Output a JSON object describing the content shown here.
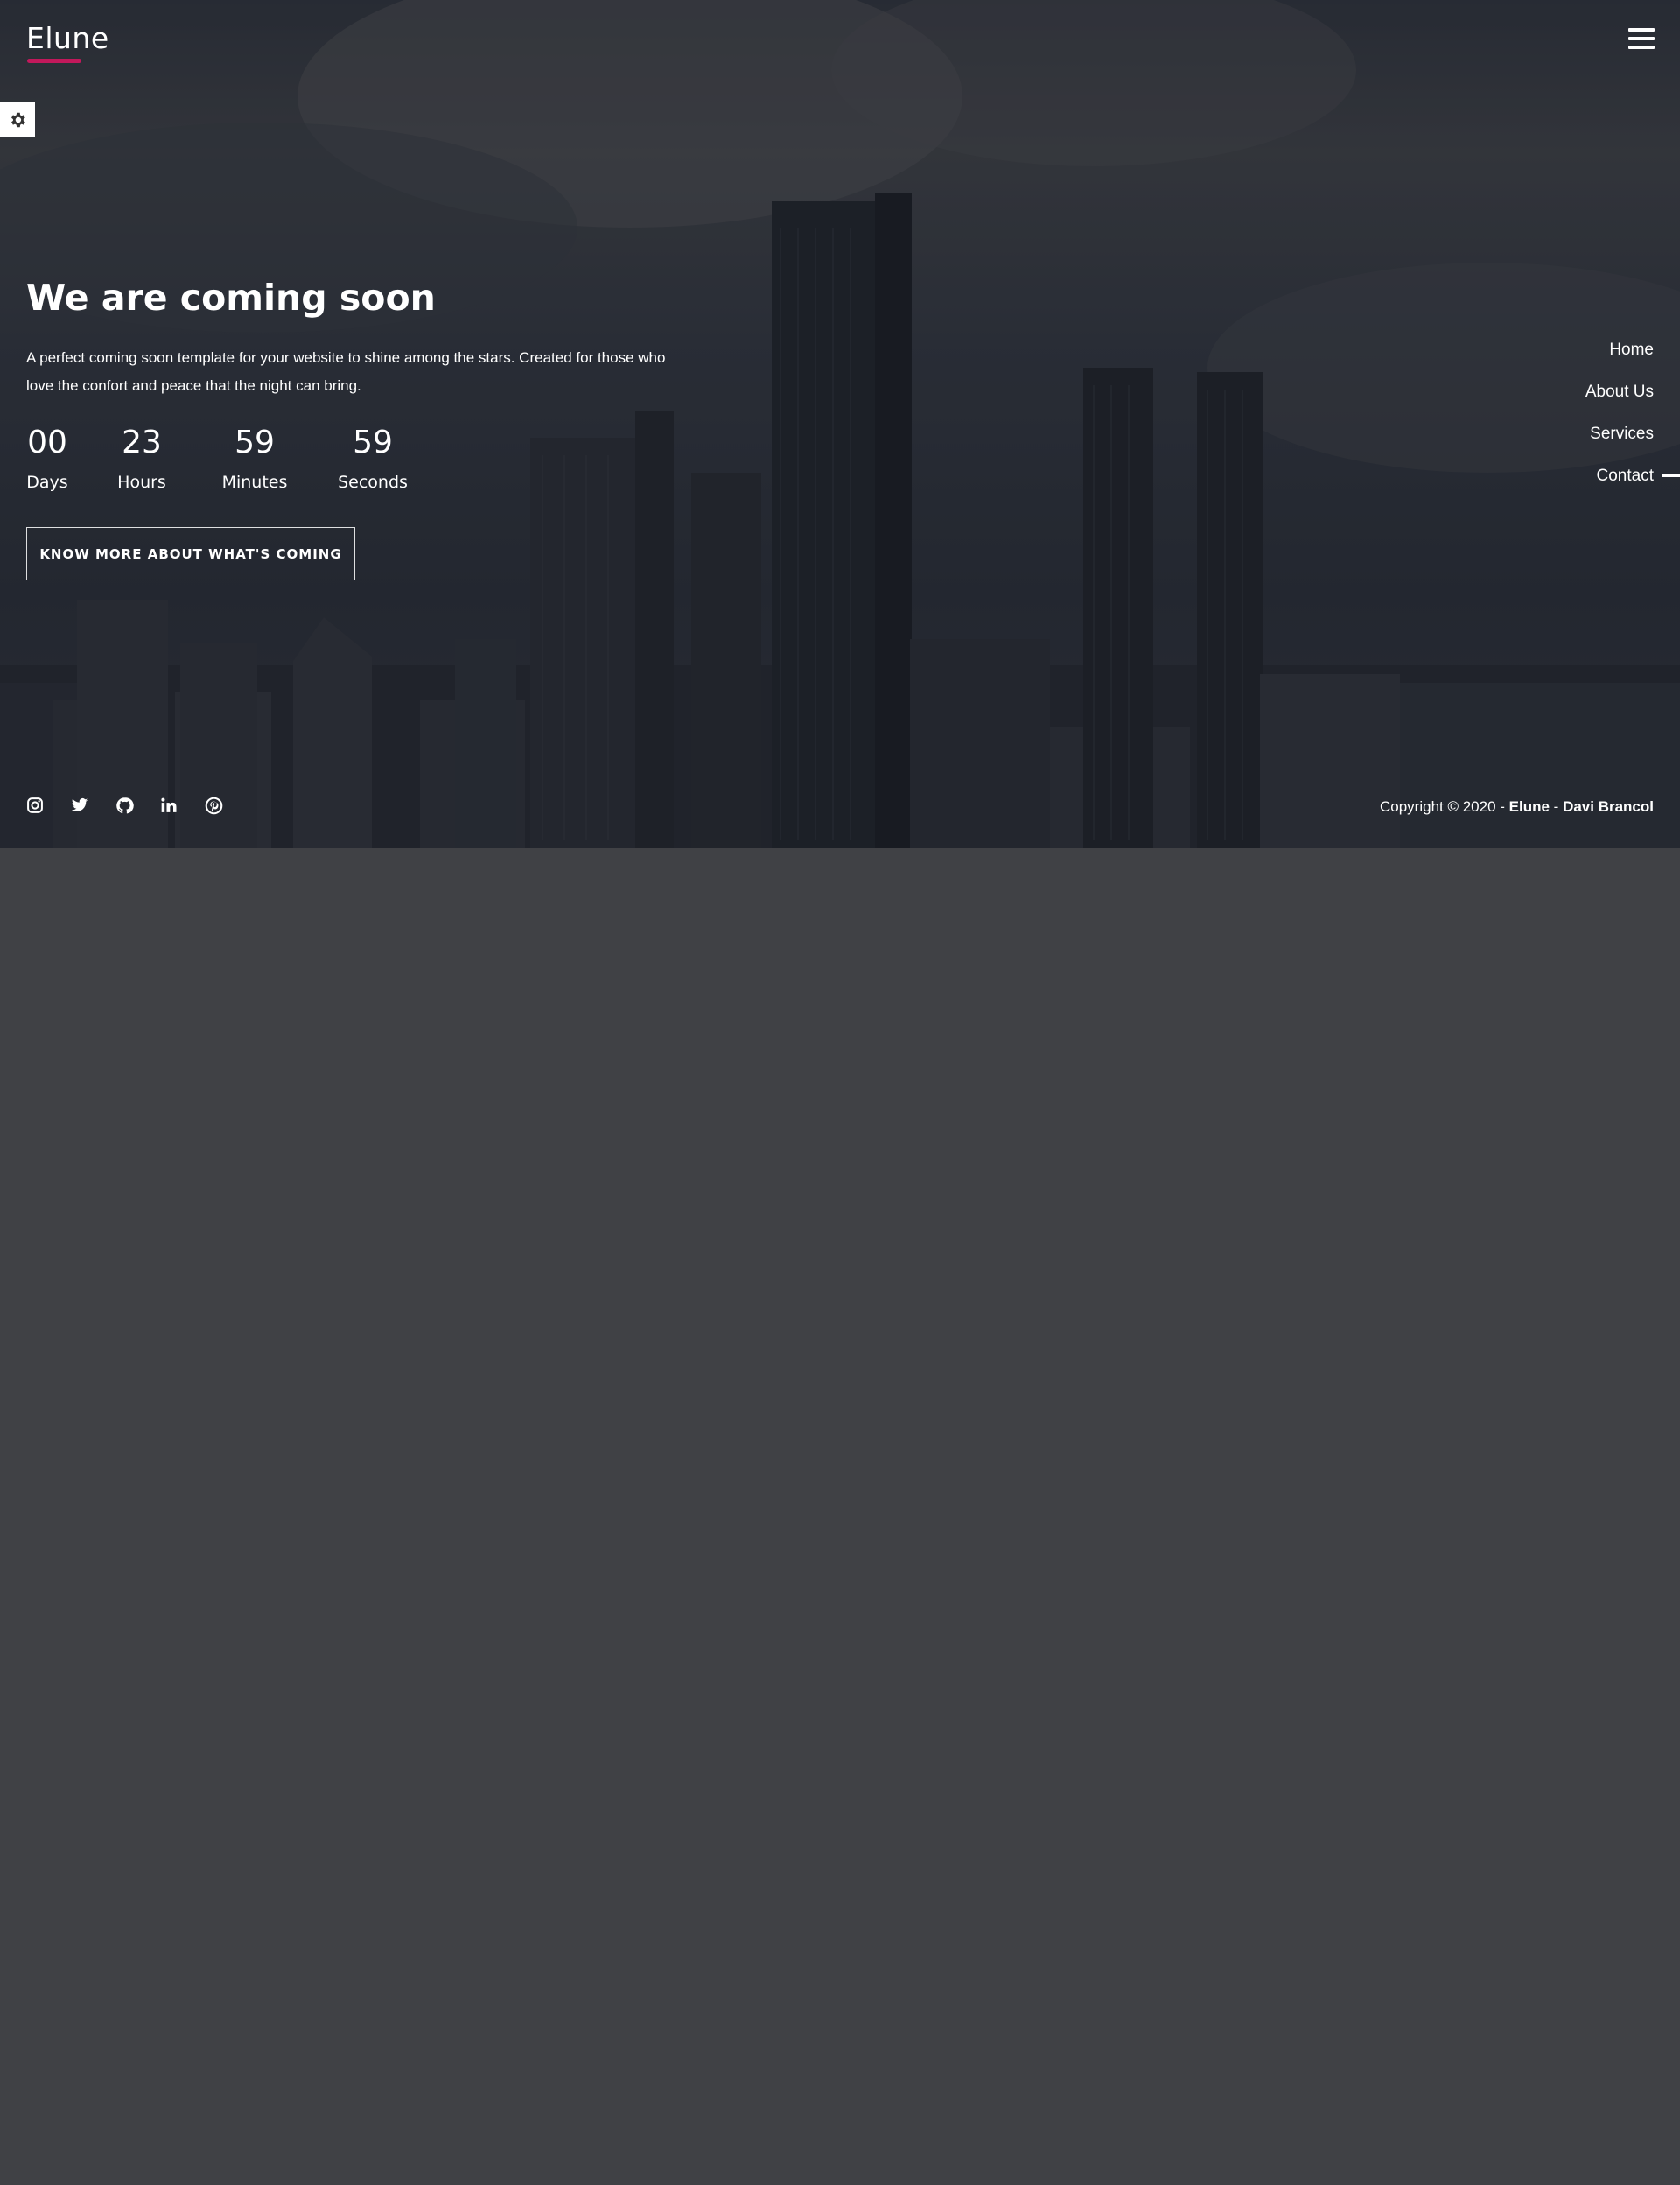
{
  "header": {
    "brand": "Elune",
    "menu_icon": "hamburger-icon",
    "settings_icon": "gear-icon",
    "accent_color": "#c2185b"
  },
  "hero": {
    "title": "We are coming soon",
    "description": "A perfect coming soon template for your website to shine among the stars. Created for those who love the confort and peace that the night can bring.",
    "countdown": [
      {
        "value": "00",
        "label": "Days"
      },
      {
        "value": "23",
        "label": "Hours"
      },
      {
        "value": "59",
        "label": "Minutes"
      },
      {
        "value": "59",
        "label": "Seconds"
      }
    ],
    "cta_label": "KNOW MORE ABOUT WHAT'S COMING"
  },
  "side_nav": {
    "items": [
      "Home",
      "About Us",
      "Services",
      "Contact"
    ],
    "active": "Contact"
  },
  "footer": {
    "socials": [
      "instagram-icon",
      "twitter-icon",
      "github-icon",
      "linkedin-icon",
      "pinterest-icon"
    ],
    "copyright_prefix": "Copyright © 2020 - ",
    "copyright_brand": "Elune",
    "copyright_sep": " - ",
    "copyright_author": "Davi Brancol"
  }
}
